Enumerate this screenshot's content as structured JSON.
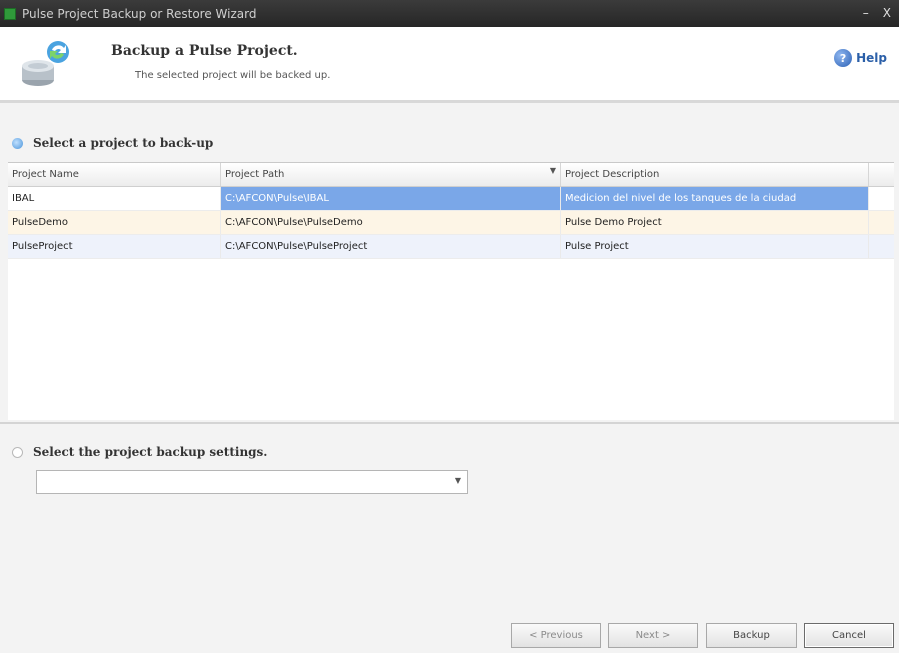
{
  "window": {
    "title": "Pulse Project Backup or Restore Wizard",
    "minimize": "–",
    "close": "X"
  },
  "header": {
    "title": "Backup a Pulse Project.",
    "subtitle": "The selected project will be backed up.",
    "help_label": "Help",
    "help_glyph": "?"
  },
  "section1": {
    "label": "Select a project to back-up"
  },
  "table": {
    "columns": [
      "Project Name",
      "Project Path",
      "Project Description"
    ],
    "rows": [
      {
        "name": "IBAL",
        "path": "C:\\AFCON\\Pulse\\IBAL",
        "description": "Medicion del nivel de los tanques de la ciudad"
      },
      {
        "name": "PulseDemo",
        "path": "C:\\AFCON\\Pulse\\PulseDemo",
        "description": "Pulse Demo Project"
      },
      {
        "name": "PulseProject",
        "path": "C:\\AFCON\\Pulse\\PulseProject",
        "description": "Pulse Project"
      }
    ]
  },
  "section2": {
    "label": "Select the project backup settings."
  },
  "settings_combo": {
    "value": ""
  },
  "buttons": {
    "previous": "< Previous",
    "next": "Next >",
    "backup": "Backup",
    "cancel": "Cancel"
  }
}
